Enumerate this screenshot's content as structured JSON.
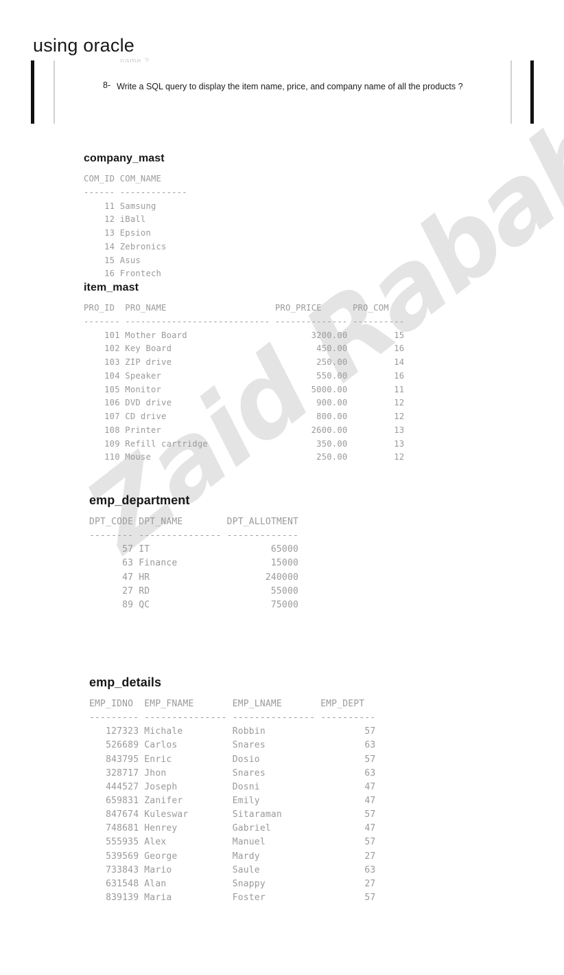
{
  "page": {
    "title": "using oracle"
  },
  "question_band": {
    "clipped_fragment": "name ?",
    "number": "8-",
    "text": "Write a SQL query to display the item name, price, and company name of all the products ?"
  },
  "watermark": {
    "text": "Zaid Rabah",
    "color": "#e3e3e3"
  },
  "tables": {
    "company_mast": {
      "caption": "company_mast",
      "columns": [
        {
          "header": "COM_ID",
          "dashes": "------",
          "width": 6,
          "align": "right"
        },
        {
          "header": "COM_NAME",
          "dashes": "-------------",
          "width": 13,
          "align": "left"
        }
      ],
      "rows": [
        [
          "11",
          "Samsung"
        ],
        [
          "12",
          "iBall"
        ],
        [
          "13",
          "Epsion"
        ],
        [
          "14",
          "Zebronics"
        ],
        [
          "15",
          "Asus"
        ],
        [
          "16",
          "Frontech"
        ]
      ]
    },
    "item_mast": {
      "caption": "item_mast",
      "columns": [
        {
          "header": "PRO_ID",
          "dashes": "-------",
          "width": 7,
          "align": "right"
        },
        {
          "header": "PRO_NAME",
          "dashes": "----------------------------",
          "width": 28,
          "align": "left"
        },
        {
          "header": "PRO_PRICE",
          "dashes": "--------------",
          "width": 14,
          "align": "right"
        },
        {
          "header": "PRO_COM",
          "dashes": "----------",
          "width": 10,
          "align": "right"
        }
      ],
      "rows": [
        [
          "101",
          "Mother Board",
          "3200.00",
          "15"
        ],
        [
          "102",
          "Key Board",
          "450.00",
          "16"
        ],
        [
          "103",
          "ZIP drive",
          "250.00",
          "14"
        ],
        [
          "104",
          "Speaker",
          "550.00",
          "16"
        ],
        [
          "105",
          "Monitor",
          "5000.00",
          "11"
        ],
        [
          "106",
          "DVD drive",
          "900.00",
          "12"
        ],
        [
          "107",
          "CD drive",
          "800.00",
          "12"
        ],
        [
          "108",
          "Printer",
          "2600.00",
          "13"
        ],
        [
          "109",
          "Refill cartridge",
          "350.00",
          "13"
        ],
        [
          "110",
          "Mouse",
          "250.00",
          "12"
        ]
      ]
    },
    "emp_department": {
      "caption": "emp_department",
      "columns": [
        {
          "header": "DPT_CODE",
          "dashes": "--------",
          "width": 8,
          "align": "right"
        },
        {
          "header": "DPT_NAME",
          "dashes": "---------------",
          "width": 15,
          "align": "left"
        },
        {
          "header": "DPT_ALLOTMENT",
          "dashes": "-------------",
          "width": 13,
          "align": "right"
        }
      ],
      "rows": [
        [
          "57",
          "IT",
          "65000"
        ],
        [
          "63",
          "Finance",
          "15000"
        ],
        [
          "47",
          "HR",
          "240000"
        ],
        [
          "27",
          "RD",
          "55000"
        ],
        [
          "89",
          "QC",
          "75000"
        ]
      ]
    },
    "emp_details": {
      "caption": "emp_details",
      "columns": [
        {
          "header": "EMP_IDNO",
          "dashes": "---------",
          "width": 9,
          "align": "right"
        },
        {
          "header": "EMP_FNAME",
          "dashes": "---------------",
          "width": 15,
          "align": "left"
        },
        {
          "header": "EMP_LNAME",
          "dashes": "---------------",
          "width": 15,
          "align": "left"
        },
        {
          "header": "EMP_DEPT",
          "dashes": "----------",
          "width": 10,
          "align": "right"
        }
      ],
      "rows": [
        [
          "127323",
          "Michale",
          "Robbin",
          "57"
        ],
        [
          "526689",
          "Carlos",
          "Snares",
          "63"
        ],
        [
          "843795",
          "Enric",
          "Dosio",
          "57"
        ],
        [
          "328717",
          "Jhon",
          "Snares",
          "63"
        ],
        [
          "444527",
          "Joseph",
          "Dosni",
          "47"
        ],
        [
          "659831",
          "Zanifer",
          "Emily",
          "47"
        ],
        [
          "847674",
          "Kuleswar",
          "Sitaraman",
          "57"
        ],
        [
          "748681",
          "Henrey",
          "Gabriel",
          "47"
        ],
        [
          "555935",
          "Alex",
          "Manuel",
          "57"
        ],
        [
          "539569",
          "George",
          "Mardy",
          "27"
        ],
        [
          "733843",
          "Mario",
          "Saule",
          "63"
        ],
        [
          "631548",
          "Alan",
          "Snappy",
          "27"
        ],
        [
          "839139",
          "Maria",
          "Foster",
          "57"
        ]
      ]
    }
  }
}
